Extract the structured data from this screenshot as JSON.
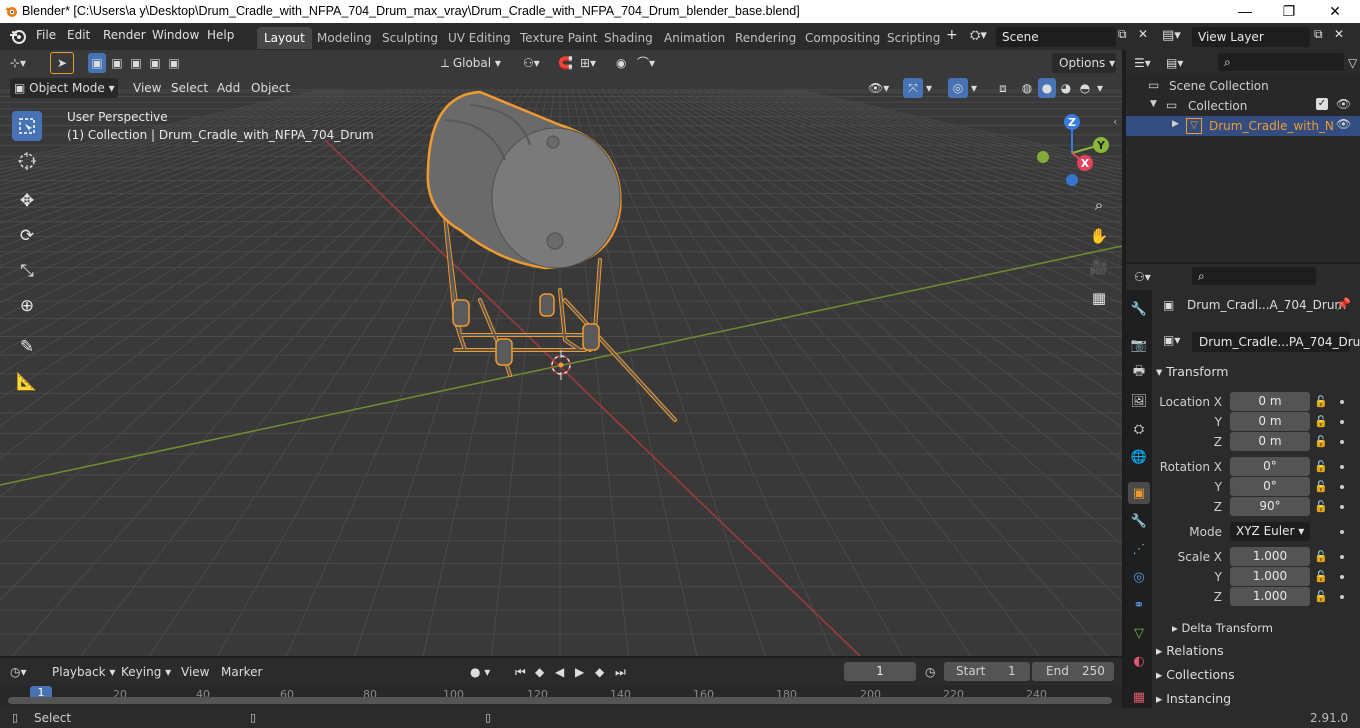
{
  "window": {
    "title": "Blender* [C:\\Users\\a y\\Desktop\\Drum_Cradle_with_NFPA_704_Drum_max_vray\\Drum_Cradle_with_NFPA_704_Drum_blender_base.blend]",
    "minimize": "—",
    "maximize": "❐",
    "close": "✕"
  },
  "menu": [
    "File",
    "Edit",
    "Render",
    "Window",
    "Help"
  ],
  "workspaces": [
    "Layout",
    "Modeling",
    "Sculpting",
    "UV Editing",
    "Texture Paint",
    "Shading",
    "Animation",
    "Rendering",
    "Compositing",
    "Scripting"
  ],
  "active_workspace": "Layout",
  "scene": {
    "label": "Scene",
    "view_layer": "View Layer"
  },
  "toolbar": {
    "orientation": "Global",
    "options": "Options"
  },
  "viewport_header": {
    "mode": "Object Mode",
    "menus": [
      "View",
      "Select",
      "Add",
      "Object"
    ]
  },
  "viewport": {
    "perspective": "User Perspective",
    "collection_info": "(1) Collection | Drum_Cradle_with_NFPA_704_Drum",
    "gizmo": {
      "x": "X",
      "y": "Y",
      "z": "Z"
    }
  },
  "outliner": {
    "scene_collection": "Scene Collection",
    "collection": "Collection",
    "object": "Drum_Cradle_with_N"
  },
  "properties": {
    "object_name": "Drum_Cradl...A_704_Drum",
    "data_name": "Drum_Cradle...PA_704_Drum",
    "transform_label": "Transform",
    "location_label": "Location X",
    "rotation_label": "Rotation X",
    "scale_label": "Scale X",
    "y_label": "Y",
    "z_label": "Z",
    "location": [
      "0 m",
      "0 m",
      "0 m"
    ],
    "rotation": [
      "0°",
      "0°",
      "90°"
    ],
    "mode_label": "Mode",
    "mode_value": "XYZ Euler",
    "scale": [
      "1.000",
      "1.000",
      "1.000"
    ],
    "delta_transform": "Delta Transform",
    "sections": [
      "Relations",
      "Collections",
      "Instancing"
    ]
  },
  "timeline": {
    "menus": [
      "Playback",
      "Keying",
      "View",
      "Marker"
    ],
    "current_frame": "1",
    "start_label": "Start",
    "start": "1",
    "end_label": "End",
    "end": "250",
    "ticks": [
      "20",
      "40",
      "60",
      "80",
      "100",
      "120",
      "140",
      "160",
      "180",
      "200",
      "220",
      "240"
    ],
    "cursor_frame": "1"
  },
  "status": {
    "action": "Select",
    "version": "2.91.0"
  },
  "colors": {
    "accent": "#4772b3",
    "selection": "#f09a2e",
    "x_axis": "#e3435a",
    "y_axis": "#8bb838",
    "z_axis": "#3a7be0"
  }
}
